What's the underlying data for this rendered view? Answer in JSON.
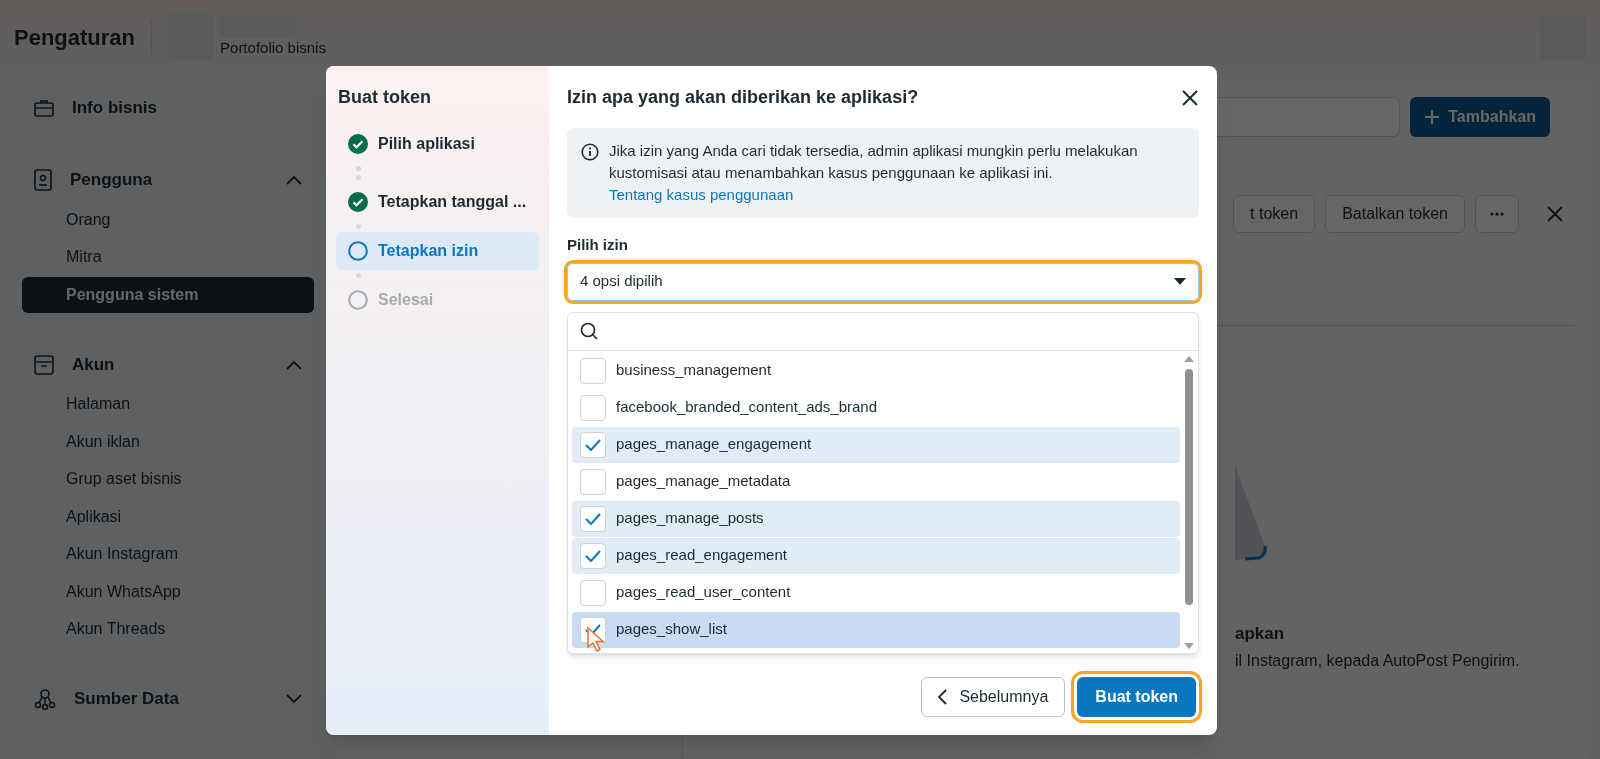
{
  "header": {
    "title": "Pengaturan",
    "portfolio_label": "Portofolio bisnis"
  },
  "sidebar": {
    "sections": [
      {
        "kind": "link",
        "label": "Info bisnis"
      },
      {
        "kind": "group",
        "label": "Pengguna",
        "expanded": true,
        "items": [
          {
            "label": "Orang",
            "selected": false
          },
          {
            "label": "Mitra",
            "selected": false
          },
          {
            "label": "Pengguna sistem",
            "selected": true
          }
        ]
      },
      {
        "kind": "group",
        "label": "Akun",
        "expanded": true,
        "items": [
          {
            "label": "Halaman",
            "selected": false
          },
          {
            "label": "Akun iklan",
            "selected": false
          },
          {
            "label": "Grup aset bisnis",
            "selected": false
          },
          {
            "label": "Aplikasi",
            "selected": false
          },
          {
            "label": "Akun Instagram",
            "selected": false
          },
          {
            "label": "Akun WhatsApp",
            "selected": false
          },
          {
            "label": "Akun Threads",
            "selected": false
          }
        ]
      },
      {
        "kind": "group",
        "label": "Sumber Data",
        "expanded": false
      }
    ]
  },
  "main": {
    "add_button": "Tambahkan",
    "token_buttons": [
      "t token",
      "Batalkan token"
    ],
    "empty_state": {
      "title": "apkan",
      "description": "il Instagram, kepada AutoPost Pengirim."
    }
  },
  "dialog": {
    "sidebar_title": "Buat token",
    "steps": [
      {
        "label": "Pilih aplikasi",
        "done": true,
        "selected": false
      },
      {
        "label": "Tetapkan tanggal ...",
        "done": true,
        "selected": false
      },
      {
        "label": "Tetapkan izin",
        "done": false,
        "selected": true
      },
      {
        "label": "Selesai",
        "done": false,
        "selected": false
      }
    ],
    "title": "Izin apa yang akan diberikan ke aplikasi?",
    "info": {
      "text": "Jika izin yang Anda cari tidak tersedia, admin aplikasi mungkin perlu melakukan kustomisasi atau menambahkan kasus penggunaan ke aplikasi ini.",
      "link": "Tentang kasus penggunaan"
    },
    "field_label": "Pilih izin",
    "select": {
      "value": "4 opsi dipilih",
      "highlighted": true
    },
    "options": [
      {
        "label": "business_management",
        "checked": false,
        "hovered": false
      },
      {
        "label": "facebook_branded_content_ads_brand",
        "checked": false,
        "hovered": false
      },
      {
        "label": "pages_manage_engagement",
        "checked": true,
        "hovered": false
      },
      {
        "label": "pages_manage_metadata",
        "checked": false,
        "hovered": false
      },
      {
        "label": "pages_manage_posts",
        "checked": true,
        "hovered": false
      },
      {
        "label": "pages_read_engagement",
        "checked": true,
        "hovered": false
      },
      {
        "label": "pages_read_user_content",
        "checked": false,
        "hovered": false
      },
      {
        "label": "pages_show_list",
        "checked": true,
        "hovered": true
      }
    ],
    "back_button": "Sebelumnya",
    "primary_button": {
      "label": "Buat token",
      "highlighted": true
    }
  }
}
